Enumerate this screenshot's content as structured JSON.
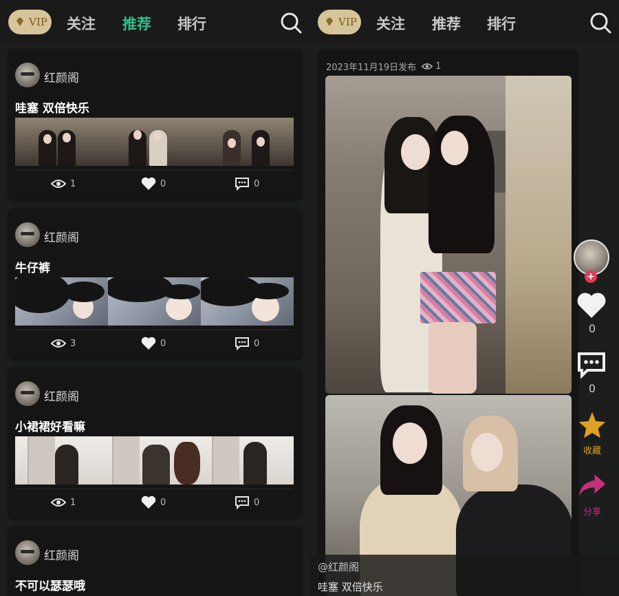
{
  "nav": {
    "vip_label": "VIP",
    "tabs": [
      "关注",
      "推荐",
      "排行"
    ],
    "active_tab": "推荐",
    "accent_color": "#2fbf8c"
  },
  "feed": {
    "cards": [
      {
        "author": "红颜阁",
        "title": "哇塞 双倍快乐",
        "views": "1",
        "likes": "0",
        "comments": "0"
      },
      {
        "author": "红颜阁",
        "title": "牛仔裤",
        "views": "3",
        "likes": "0",
        "comments": "0"
      },
      {
        "author": "红颜阁",
        "title": "小裙裙好看嘛",
        "views": "1",
        "likes": "0",
        "comments": "0"
      },
      {
        "author": "红颜阁",
        "title": "不可以瑟瑟哦"
      }
    ]
  },
  "detail": {
    "publish_date": "2023年11月19日发布",
    "view_count": "1",
    "like_count": "0",
    "comment_count": "0",
    "favorite_label": "收藏",
    "share_label": "分享",
    "handle": "@红颜阁",
    "caption": "哇塞 双倍快乐",
    "favorite_color": "#e0a024",
    "share_color": "#c4307a"
  }
}
